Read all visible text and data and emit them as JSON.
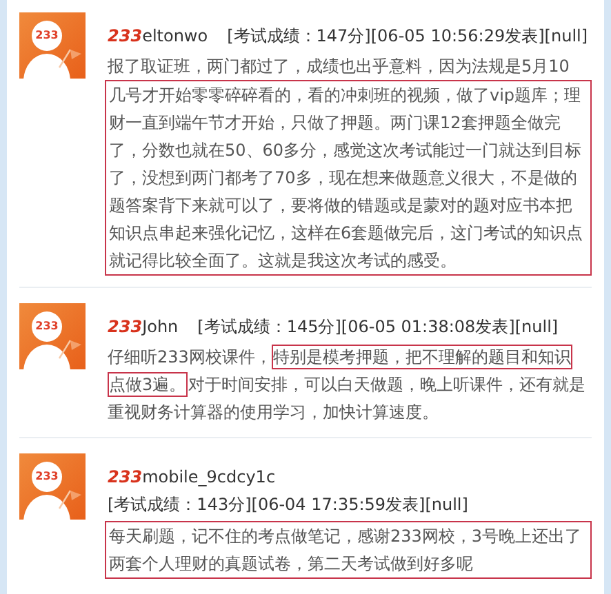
{
  "posts": [
    {
      "avatar_label": "233",
      "brand": "233",
      "username": "eltonwo",
      "meta": "[考试成绩：147分][06-05 10:56:29发表][null]",
      "meta_on_new_line": false,
      "paragraphs": [
        {
          "boxed": false,
          "lines": [
            [
              {
                "text": "报了取证班，两门都过了，成绩也出乎意料，因为法规是5月10",
                "marked": false
              }
            ]
          ]
        },
        {
          "boxed": true,
          "lines": [
            [
              {
                "text": "几号才开始零零碎碎看的，看的冲刺班的视频，做了vip题库；理",
                "marked": false
              }
            ],
            [
              {
                "text": "财一直到端午节才开始，只做了押题。两门课12套押题全做完",
                "marked": false
              }
            ],
            [
              {
                "text": "了，分数也就在50、60多分，感觉这次考试能过一门就达到目标",
                "marked": false
              }
            ],
            [
              {
                "text": "了，没想到两门都考了70多，现在想来做题意义很大，不是做的",
                "marked": false
              }
            ],
            [
              {
                "text": "题答案背下来就可以了，要将做的错题或是蒙对的题对应书本把",
                "marked": false
              }
            ],
            [
              {
                "text": "知识点串起来强化记忆，这样在6套题做完后，这门考试的知识点",
                "marked": false
              }
            ],
            [
              {
                "text": "就记得比较全面了。这就是我这次考试的感受。",
                "marked": false
              }
            ]
          ]
        }
      ]
    },
    {
      "avatar_label": "233",
      "brand": "233",
      "username": "John",
      "meta": "[考试成绩：145分][06-05 01:38:08发表][null]",
      "meta_on_new_line": false,
      "paragraphs": [
        {
          "boxed": false,
          "lines": [
            [
              {
                "text": "仔细听233网校课件，",
                "marked": false
              },
              {
                "text": "特别是模考押题，把不理解的题目和知识",
                "marked": true
              }
            ],
            [
              {
                "text": "点做3遍。",
                "marked": true
              },
              {
                "text": "对于时间安排，可以白天做题，晚上听课件，还有就是",
                "marked": false
              }
            ],
            [
              {
                "text": "重视财务计算器的使用学习，加快计算速度。",
                "marked": false
              }
            ]
          ]
        }
      ]
    },
    {
      "avatar_label": "233",
      "brand": "233",
      "username": "mobile_9cdcy1c",
      "meta": "[考试成绩：143分][06-04 17:35:59发表][null]",
      "meta_on_new_line": true,
      "paragraphs": [
        {
          "boxed": true,
          "lines": [
            [
              {
                "text": "每天刷题，记不住的考点做笔记，感谢233网校，3号晚上还出了",
                "marked": false
              }
            ],
            [
              {
                "text": "两套个人理财的真题试卷，第二天考试做到好多呢",
                "marked": false
              }
            ]
          ]
        }
      ]
    }
  ]
}
